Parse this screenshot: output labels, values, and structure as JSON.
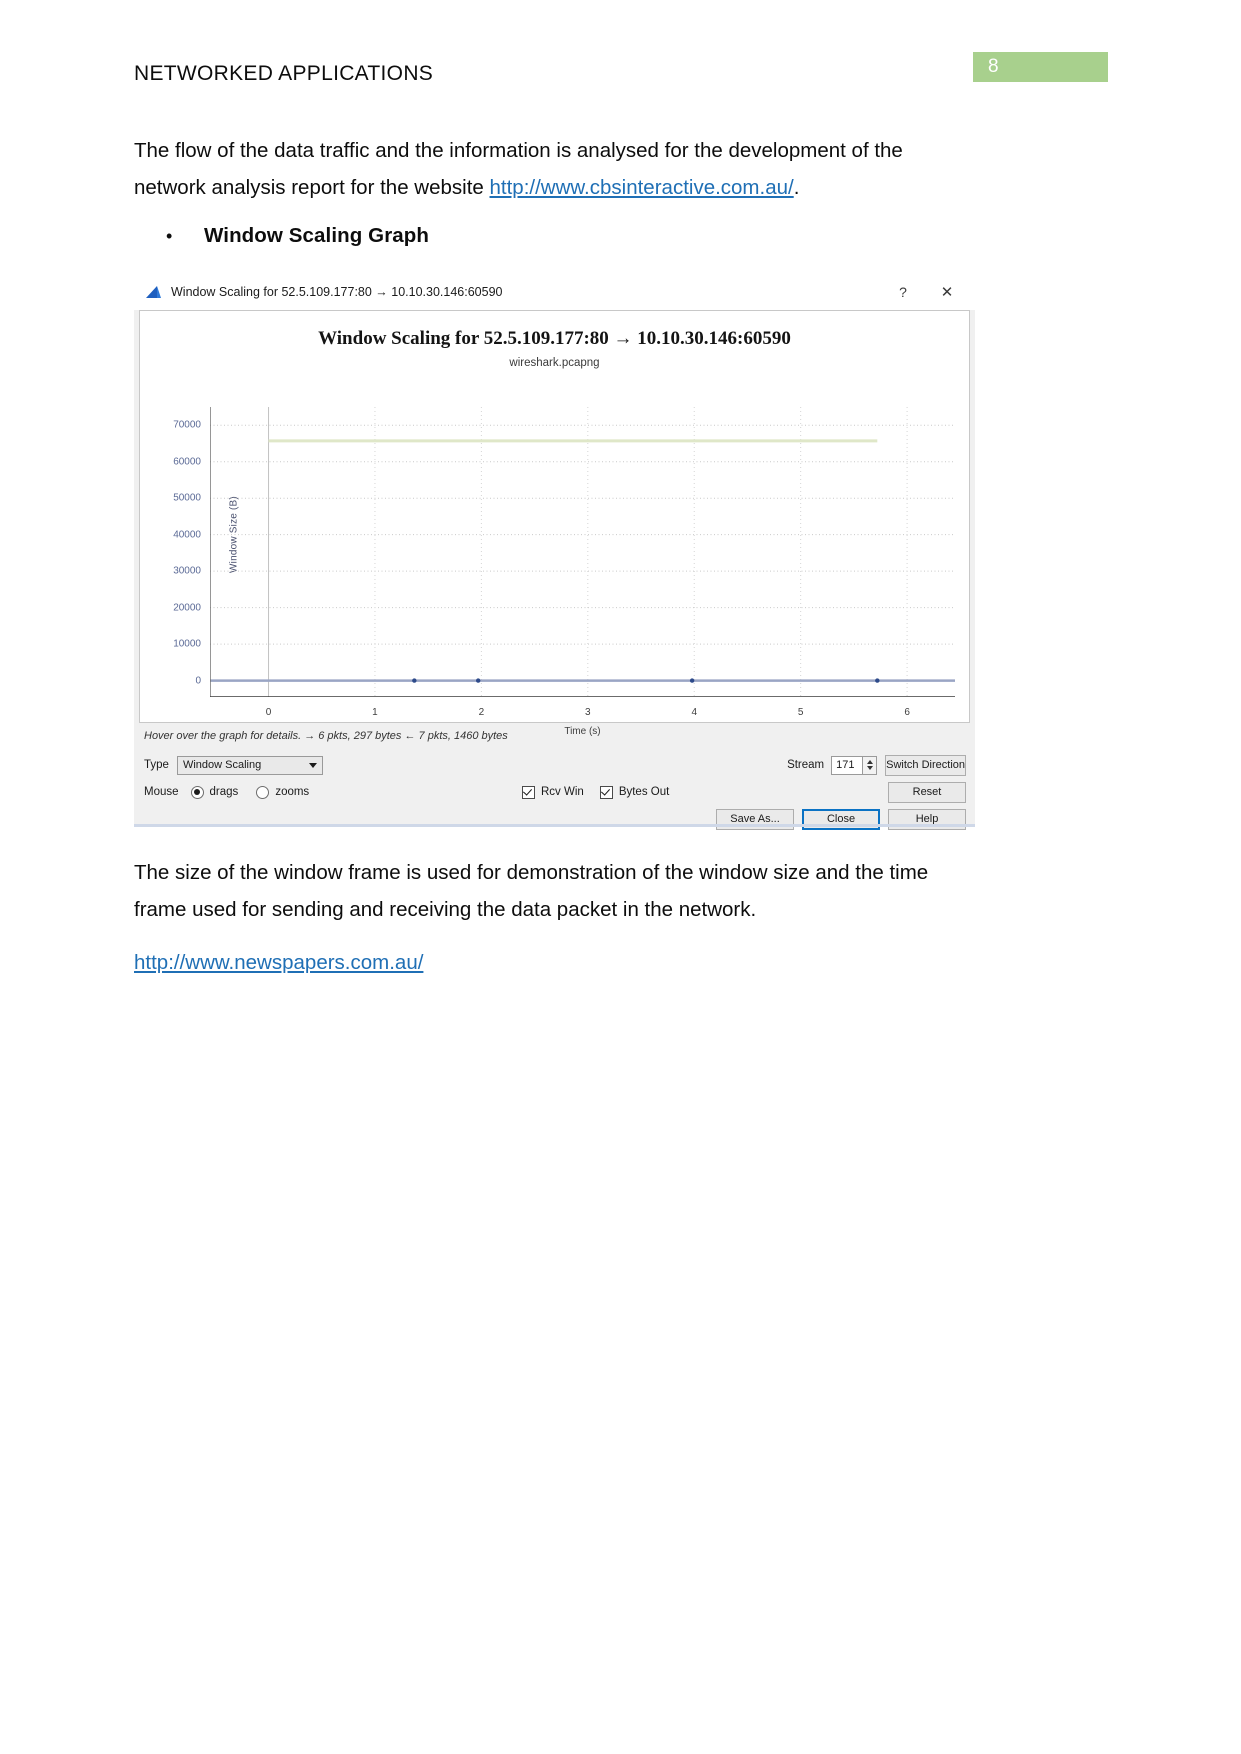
{
  "document": {
    "header_title": "NETWORKED APPLICATIONS",
    "page_number": "8",
    "paragraph_1_before_link": "The flow of the data traffic and the information is analysed for the development of the network analysis report for the website ",
    "paragraph_1_link": "http://www.cbsinteractive.com.au/",
    "paragraph_1_after_link": ".",
    "bullet_dot": "•",
    "bullet_label": "Window Scaling Graph",
    "paragraph_2": "The size of the window frame is used for demonstration of the window size and the time frame used for sending and receiving the data packet in the network.",
    "paragraph_3_link": "http://www.newspapers.com.au/"
  },
  "dialog": {
    "titlebar": {
      "icon_name": "wireshark-shark-fin-icon",
      "title": "Window Scaling for 52.5.109.177:80 → 10.10.30.146:60590",
      "help_label": "?",
      "close_label": "✕"
    },
    "hint_text": "Hover over the graph for details. → 6 pkts, 297 bytes ← 7 pkts, 1460 bytes",
    "controls": {
      "type_label": "Type",
      "type_value": "Window Scaling",
      "type_options": [
        "Window Scaling"
      ],
      "mouse_label": "Mouse",
      "mouse_option_drags": "drags",
      "mouse_option_zooms": "zooms",
      "mouse_selected": "drags",
      "checkbox_rcv_win": "Rcv Win",
      "checkbox_rcv_win_checked": true,
      "checkbox_bytes_out": "Bytes Out",
      "checkbox_bytes_out_checked": true,
      "stream_label": "Stream",
      "stream_value": "171",
      "switch_direction_label": "Switch Direction",
      "reset_label": "Reset",
      "save_as_label": "Save As...",
      "close_label": "Close",
      "help_label": "Help"
    }
  },
  "chart_data": {
    "type": "line",
    "title": "Window Scaling for 52.5.109.177:80 → 10.10.30.146:60590",
    "subtitle": "wireshark.pcapng",
    "xlabel": "Time (s)",
    "ylabel": "Window Size (B)",
    "xlim": [
      -0.55,
      6.45
    ],
    "ylim": [
      -4500,
      75000
    ],
    "xticks": [
      0,
      1,
      2,
      3,
      4,
      5,
      6
    ],
    "yticks": [
      0,
      10000,
      20000,
      30000,
      40000,
      50000,
      60000,
      70000
    ],
    "xtick_labels": [
      "0",
      "1",
      "2",
      "3",
      "4",
      "5",
      "6"
    ],
    "ytick_labels": [
      "0",
      "10000",
      "20000",
      "30000",
      "40000",
      "50000",
      "60000",
      "70000"
    ],
    "grid": true,
    "legend_position": "none",
    "series": [
      {
        "name": "Rcv Win",
        "color": "#dfe7c8",
        "style": "step-line",
        "x": [
          0.0,
          1.37,
          1.97,
          3.98,
          5.72
        ],
        "y": [
          65700,
          65700,
          65700,
          65700,
          65700
        ]
      },
      {
        "name": "Bytes Out",
        "color": "#9aa5c4",
        "style": "line-with-markers",
        "marker_color": "#2d4a8a",
        "x": [
          -0.55,
          1.37,
          1.97,
          3.98,
          5.72,
          6.45
        ],
        "y": [
          0,
          0,
          0,
          0,
          0,
          0
        ],
        "marker_x": [
          1.37,
          1.97,
          3.98,
          5.72
        ],
        "marker_y": [
          0,
          0,
          0,
          0
        ]
      }
    ]
  },
  "colors": {
    "page_badge_bg": "#a8d08d",
    "link": "#1f6fb5",
    "rcv_win_line": "#dfe7c8",
    "bytes_out_line": "#9aa5c4",
    "marker": "#2d4a8a",
    "focus_border": "#0a72c4"
  }
}
